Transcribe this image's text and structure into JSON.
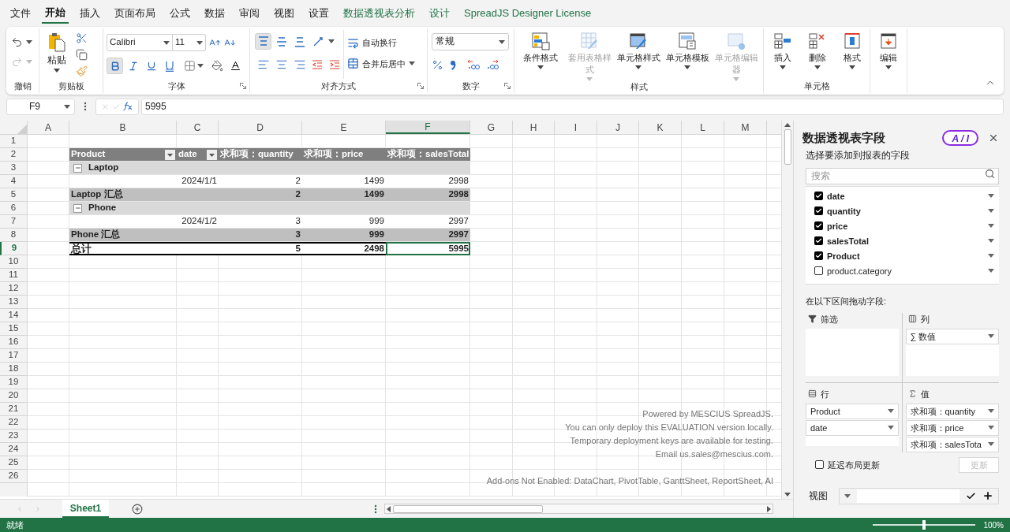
{
  "menu": [
    {
      "label": "文件",
      "selected": false,
      "contextual": false
    },
    {
      "label": "开始",
      "selected": true,
      "contextual": false
    },
    {
      "label": "插入",
      "selected": false,
      "contextual": false
    },
    {
      "label": "页面布局",
      "selected": false,
      "contextual": false
    },
    {
      "label": "公式",
      "selected": false,
      "contextual": false
    },
    {
      "label": "数据",
      "selected": false,
      "contextual": false
    },
    {
      "label": "审阅",
      "selected": false,
      "contextual": false
    },
    {
      "label": "视图",
      "selected": false,
      "contextual": false
    },
    {
      "label": "设置",
      "selected": false,
      "contextual": false
    },
    {
      "label": "数据透视表分析",
      "selected": false,
      "contextual": true
    },
    {
      "label": "设计",
      "selected": false,
      "contextual": true
    },
    {
      "label": "SpreadJS Designer License",
      "selected": false,
      "contextual": true
    }
  ],
  "ribbon": {
    "history": {
      "label": "撤销",
      "buttons": [
        {
          "kind": "undo",
          "disabled": false
        },
        {
          "kind": "redo",
          "disabled": true
        }
      ]
    },
    "clipboard": {
      "label": "剪贴板",
      "paste": "粘贴"
    },
    "font": {
      "label": "字体",
      "family": "Calibri",
      "size": "11",
      "toggles": [
        {
          "kind": "bold",
          "selected": true
        },
        {
          "kind": "italic",
          "selected": false
        },
        {
          "kind": "underline",
          "selected": false
        },
        {
          "kind": "double_underline",
          "selected": false
        }
      ]
    },
    "alignment": {
      "label": "对齐方式",
      "vertical": [
        {
          "kind": "top",
          "selected": true
        },
        {
          "kind": "middle",
          "selected": false
        },
        {
          "kind": "bottom",
          "selected": false
        }
      ],
      "horizontal": [
        {
          "kind": "left",
          "selected": false
        },
        {
          "kind": "center",
          "selected": false
        },
        {
          "kind": "right",
          "selected": false
        }
      ],
      "wrap": "自动换行",
      "merge": "合并后居中"
    },
    "number": {
      "label": "数字",
      "format": "常规"
    },
    "styles": {
      "label": "样式",
      "buttons": [
        {
          "kind": "conditional",
          "label": "条件格式",
          "disabled": false
        },
        {
          "kind": "table_style",
          "label": "套用表格样式",
          "disabled": true
        },
        {
          "kind": "cell_style",
          "label": "单元格样式",
          "disabled": false
        },
        {
          "kind": "template",
          "label": "单元格模板",
          "disabled": false
        },
        {
          "kind": "editor",
          "label": "单元格编辑器",
          "disabled": true
        }
      ]
    },
    "cells": {
      "label": "单元格",
      "buttons": [
        {
          "kind": "insert",
          "label": "插入",
          "disabled": false
        },
        {
          "kind": "delete",
          "label": "删除",
          "disabled": false
        },
        {
          "kind": "format",
          "label": "格式",
          "disabled": false
        }
      ]
    },
    "editing": {
      "buttons": [
        {
          "kind": "edit",
          "label": "编辑",
          "disabled": false
        }
      ]
    }
  },
  "formula_bar": {
    "name_box": "F9",
    "formula": "5995"
  },
  "sheet": {
    "columns": [
      {
        "label": "A",
        "selected": false
      },
      {
        "label": "B",
        "selected": false
      },
      {
        "label": "C",
        "selected": false
      },
      {
        "label": "D",
        "selected": false
      },
      {
        "label": "E",
        "selected": false
      },
      {
        "label": "F",
        "selected": true
      },
      {
        "label": "G",
        "selected": false
      },
      {
        "label": "H",
        "selected": false
      },
      {
        "label": "I",
        "selected": false
      },
      {
        "label": "J",
        "selected": false
      },
      {
        "label": "K",
        "selected": false
      },
      {
        "label": "L",
        "selected": false
      },
      {
        "label": "M",
        "selected": false
      }
    ],
    "rows": [
      {
        "label": "1",
        "selected": false
      },
      {
        "label": "2",
        "selected": false
      },
      {
        "label": "3",
        "selected": false
      },
      {
        "label": "4",
        "selected": false
      },
      {
        "label": "5",
        "selected": false
      },
      {
        "label": "6",
        "selected": false
      },
      {
        "label": "7",
        "selected": false
      },
      {
        "label": "8",
        "selected": false
      },
      {
        "label": "9",
        "selected": true
      },
      {
        "label": "10",
        "selected": false
      },
      {
        "label": "11",
        "selected": false
      },
      {
        "label": "12",
        "selected": false
      },
      {
        "label": "13",
        "selected": false
      },
      {
        "label": "14",
        "selected": false
      },
      {
        "label": "15",
        "selected": false
      },
      {
        "label": "16",
        "selected": false
      },
      {
        "label": "17",
        "selected": false
      },
      {
        "label": "18",
        "selected": false
      },
      {
        "label": "19",
        "selected": false
      },
      {
        "label": "20",
        "selected": false
      },
      {
        "label": "21",
        "selected": false
      },
      {
        "label": "22",
        "selected": false
      },
      {
        "label": "23",
        "selected": false
      },
      {
        "label": "24",
        "selected": false
      },
      {
        "label": "25",
        "selected": false
      },
      {
        "label": "26",
        "selected": false
      }
    ],
    "notice": [
      "Powered by MESCIUS SpreadJS.",
      "You can only deploy this EVALUATION version locally.",
      "Temporary deployment keys are available for testing.",
      "Email us.sales@mescius.com."
    ],
    "addons_notice": "Add-ons Not Enabled: DataChart, PivotTable, GanttSheet, ReportSheet, AI"
  },
  "pivot": {
    "rows": [
      {
        "kind": "header",
        "cells": [
          {
            "text": "Product",
            "filter": true
          },
          {
            "text": "date",
            "filter": true
          },
          {
            "text": "求和项：quantity",
            "filter": false
          },
          {
            "text": "求和项：price",
            "filter": false
          },
          {
            "text": "求和项：salesTotal",
            "filter": false
          }
        ]
      },
      {
        "kind": "group",
        "label": "Laptop",
        "expanded": true
      },
      {
        "kind": "item",
        "cells": [
          "",
          "2024/1/1",
          "2",
          "1499",
          "2998"
        ]
      },
      {
        "kind": "subtotal",
        "cells": [
          "Laptop 汇总",
          "",
          "2",
          "1499",
          "2998"
        ]
      },
      {
        "kind": "group",
        "label": "Phone",
        "expanded": true
      },
      {
        "kind": "item",
        "cells": [
          "",
          "2024/1/2",
          "3",
          "999",
          "2997"
        ]
      },
      {
        "kind": "subtotal",
        "cells": [
          "Phone 汇总",
          "",
          "3",
          "999",
          "2997"
        ]
      },
      {
        "kind": "total",
        "cells": [
          "总计",
          "",
          "5",
          "2498",
          "5995"
        ]
      }
    ]
  },
  "sheet_tabs": [
    {
      "label": "Sheet1",
      "selected": true
    }
  ],
  "status_bar": {
    "text": "就绪",
    "zoom": "100%",
    "level": 0.5
  },
  "field_panel": {
    "title": "数据透视表字段",
    "ai_button": "A / I",
    "subtitle": "选择要添加到报表的字段",
    "search_placeholder": "搜索",
    "fields": [
      {
        "label": "date",
        "checked": true
      },
      {
        "label": "quantity",
        "checked": true
      },
      {
        "label": "price",
        "checked": true
      },
      {
        "label": "salesTotal",
        "checked": true
      },
      {
        "label": "Product",
        "checked": true
      },
      {
        "label": "product.category",
        "checked": false
      }
    ],
    "drag_hint": "在以下区间拖动字段:",
    "areas": [
      {
        "kind": "filter",
        "label": "筛选"
      },
      {
        "kind": "columns",
        "label": "列",
        "items": [
          "∑ 数值"
        ]
      },
      {
        "kind": "rows",
        "label": "行",
        "items": [
          "Product",
          "date"
        ]
      },
      {
        "kind": "values",
        "label": "值",
        "items": [
          "求和项：quantity",
          "求和项：price",
          "求和项：salesTota"
        ]
      }
    ],
    "defer_update": {
      "label": "延迟布局更新",
      "checked": false
    },
    "update_button": {
      "label": "更新",
      "disabled": true
    },
    "view_label": "视图"
  }
}
